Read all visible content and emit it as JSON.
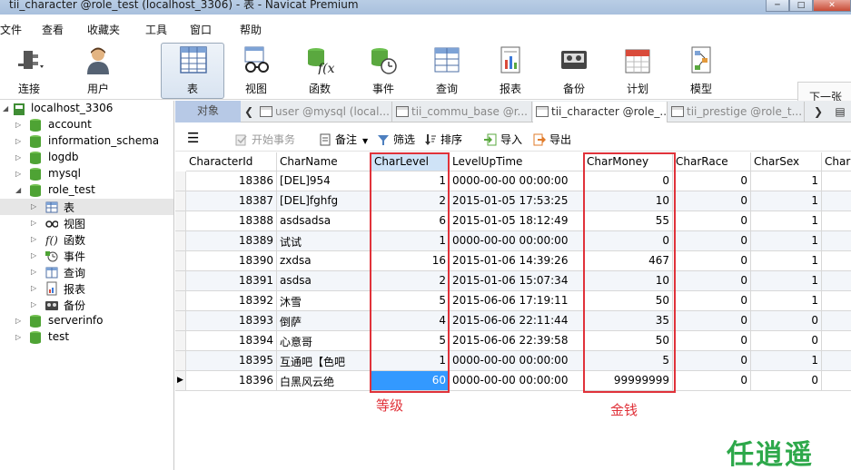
{
  "window": {
    "title": "tii_character @role_test (localhost_3306) - 表 - Navicat Premium",
    "controls": [
      "─",
      "□",
      "✕"
    ]
  },
  "menu": [
    "文件",
    "查看",
    "收藏夹",
    "工具",
    "窗口",
    "帮助"
  ],
  "toolbar": {
    "buttons": [
      {
        "label": "连接",
        "icon": "plug-icon"
      },
      {
        "label": "用户",
        "icon": "user-icon"
      },
      {
        "label": "表",
        "icon": "table-icon"
      },
      {
        "label": "视图",
        "icon": "view-glasses-icon"
      },
      {
        "label": "函数",
        "icon": "function-icon"
      },
      {
        "label": "事件",
        "icon": "event-clock-icon"
      },
      {
        "label": "查询",
        "icon": "query-grid-icon"
      },
      {
        "label": "报表",
        "icon": "report-icon"
      },
      {
        "label": "备份",
        "icon": "backup-tape-icon"
      },
      {
        "label": "计划",
        "icon": "calendar-icon"
      },
      {
        "label": "模型",
        "icon": "model-diagram-icon"
      }
    ],
    "next_label": "下一张"
  },
  "sidebar": {
    "items": [
      {
        "label": "localhost_3306",
        "icon": "connection-icon"
      },
      {
        "label": "account",
        "icon": "database-icon"
      },
      {
        "label": "information_schema",
        "icon": "database-icon"
      },
      {
        "label": "logdb",
        "icon": "database-icon"
      },
      {
        "label": "mysql",
        "icon": "database-icon"
      },
      {
        "label": "role_test",
        "icon": "database-icon"
      },
      {
        "label": "表",
        "icon": "table-icon"
      },
      {
        "label": "视图",
        "icon": "view-glasses-icon"
      },
      {
        "label": "函数",
        "icon": "function-icon"
      },
      {
        "label": "事件",
        "icon": "event-clock-icon"
      },
      {
        "label": "查询",
        "icon": "query-grid-icon"
      },
      {
        "label": "报表",
        "icon": "report-icon"
      },
      {
        "label": "备份",
        "icon": "backup-tape-icon"
      },
      {
        "label": "serverinfo",
        "icon": "database-icon"
      },
      {
        "label": "test",
        "icon": "database-icon"
      }
    ]
  },
  "tabs": {
    "objects_label": "对象",
    "items": [
      {
        "label": "user @mysql (local..."
      },
      {
        "label": "tii_commu_base @r..."
      },
      {
        "label": "tii_character @role_..."
      },
      {
        "label": "tii_prestige @role_t..."
      }
    ]
  },
  "obj_toolbar": {
    "begin_tx": "开始事务",
    "memo": "备注",
    "filter": "筛选",
    "sort": "排序",
    "import": "导入",
    "export": "导出"
  },
  "grid": {
    "columns": [
      "CharacterId",
      "CharName",
      "CharLevel",
      "LevelUpTime",
      "CharMoney",
      "CharRace",
      "CharSex",
      "Char"
    ],
    "rows": [
      [
        "18386",
        "[DEL]954",
        "1",
        "0000-00-00 00:00:00",
        "0",
        "0",
        "1"
      ],
      [
        "18387",
        "[DEL]fghfg",
        "2",
        "2015-01-05 17:53:25",
        "10",
        "0",
        "1"
      ],
      [
        "18388",
        "asdsadsa",
        "6",
        "2015-01-05 18:12:49",
        "55",
        "0",
        "1"
      ],
      [
        "18389",
        "试试",
        "1",
        "0000-00-00 00:00:00",
        "0",
        "0",
        "1"
      ],
      [
        "18390",
        "zxdsa",
        "16",
        "2015-01-06 14:39:26",
        "467",
        "0",
        "1"
      ],
      [
        "18391",
        "asdsa",
        "2",
        "2015-01-06 15:07:34",
        "10",
        "0",
        "1"
      ],
      [
        "18392",
        "沐雪",
        "5",
        "2015-06-06 17:19:11",
        "50",
        "0",
        "1"
      ],
      [
        "18393",
        "倒萨",
        "4",
        "2015-06-06 22:11:44",
        "35",
        "0",
        "0"
      ],
      [
        "18394",
        "心意哥",
        "5",
        "2015-06-06 22:39:58",
        "50",
        "0",
        "0"
      ],
      [
        "18395",
        "互通吧【色吧",
        "1",
        "0000-00-00 00:00:00",
        "5",
        "0",
        "1"
      ],
      [
        "18396",
        "白黑风云绝",
        "60",
        "0000-00-00 00:00:00",
        "99999999",
        "0",
        "0"
      ]
    ]
  },
  "annotations": {
    "level_label": "等级",
    "money_label": "金钱",
    "accent_color": "#e0323a"
  },
  "watermark": "任逍遥"
}
